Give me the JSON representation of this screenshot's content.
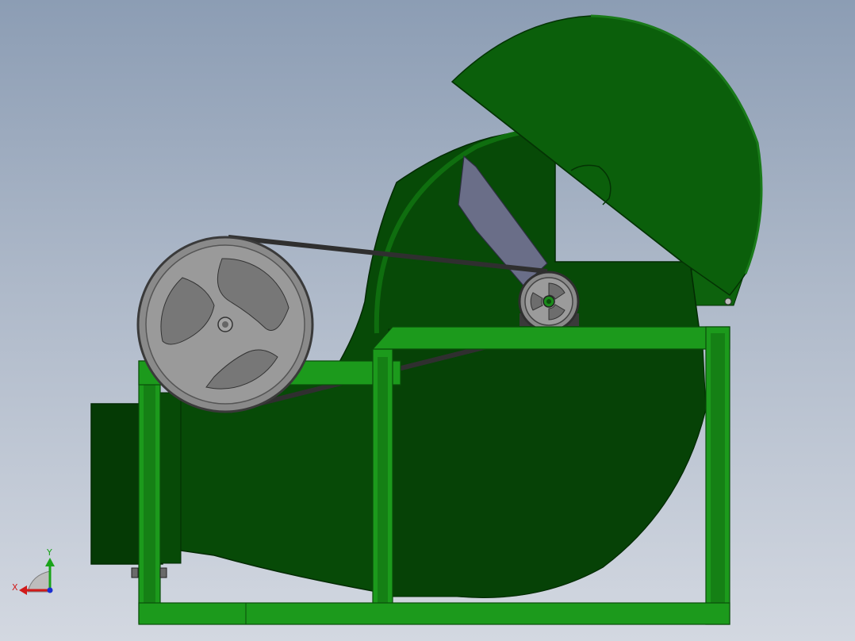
{
  "triad": {
    "x_label": "X",
    "y_label": "Y"
  },
  "colors": {
    "background_top": "#8c9db4",
    "background_bottom": "#d3d8e1",
    "housing_dark": "#064206",
    "housing_mid": "#0b5a0b",
    "housing_light": "#137013",
    "frame": "#1c9a1c",
    "frame_edge": "#0a4d0a",
    "pulley": "#8f8f8f",
    "belt": "#2e2e2e",
    "motor": "#1f3c8a",
    "axis_x": "#d11a1a",
    "axis_y": "#1aa31a",
    "axis_z": "#1a2ed1"
  }
}
